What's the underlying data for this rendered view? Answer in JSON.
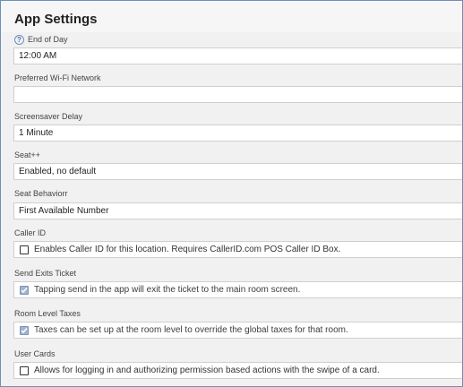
{
  "title": "App Settings",
  "fields": [
    {
      "label": "End of Day",
      "value": "12:00 AM"
    },
    {
      "label": "Preferred Wi-Fi Network",
      "value": ""
    },
    {
      "label": "Screensaver Delay",
      "value": "1 Minute"
    },
    {
      "label": "Seat++",
      "value": "Enabled, no default"
    },
    {
      "label": "Seat Behaviorr",
      "value": "First Available Number"
    },
    {
      "label": "Caller ID",
      "text": "Enables Caller ID for this location. Requires CallerID.com POS Caller ID Box.",
      "checked": false
    },
    {
      "label": "Send Exits Ticket",
      "text": "Tapping send in the app will exit the ticket to the main room screen.",
      "checked": true
    },
    {
      "label": "Room Level Taxes",
      "text": "Taxes can be set up at the room level to override the global taxes for that room.",
      "checked": true
    },
    {
      "label": "User Cards",
      "text": "Allows for logging in and authorizing permission based actions with the swipe of a card.",
      "checked": false
    }
  ],
  "icons": {
    "help": "question-circle-icon",
    "check": "checkmark-icon"
  }
}
